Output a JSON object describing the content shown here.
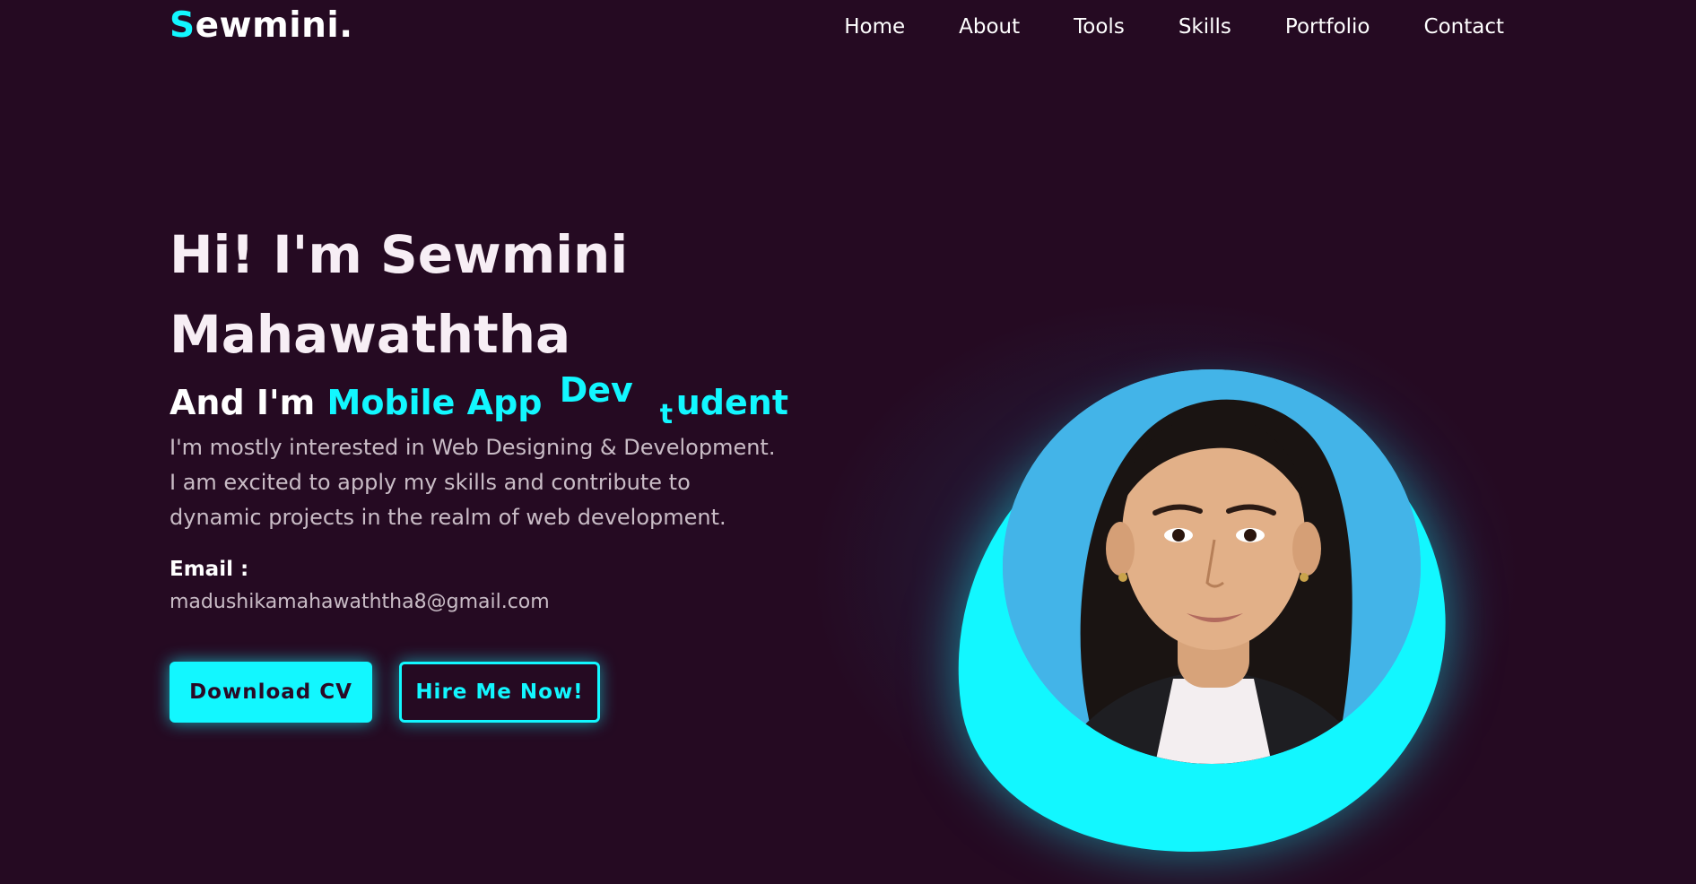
{
  "logo": {
    "first": "S",
    "rest": "ewmini."
  },
  "nav": [
    "Home",
    "About",
    "Tools",
    "Skills",
    "Portfolio",
    "Contact"
  ],
  "hero": {
    "title": "Hi! I'm Sewmini Mahawaththa",
    "sub_prefix": "And I'm",
    "role": "Mobile App",
    "typed_a": "Dev",
    "typed_b": "t",
    "typed_c": "udent",
    "description": "I'm mostly interested in Web Designing & Development. I am excited to apply my skills and contribute to dynamic projects in the realm of web development.",
    "email_label": "Email :",
    "email": "madushikamahawaththa8@gmail.com"
  },
  "buttons": {
    "cv": "Download CV",
    "hire": "Hire Me Now!"
  },
  "colors": {
    "background": "#250a22",
    "accent": "#12f7ff",
    "photo_bg": "#43b4e8"
  }
}
